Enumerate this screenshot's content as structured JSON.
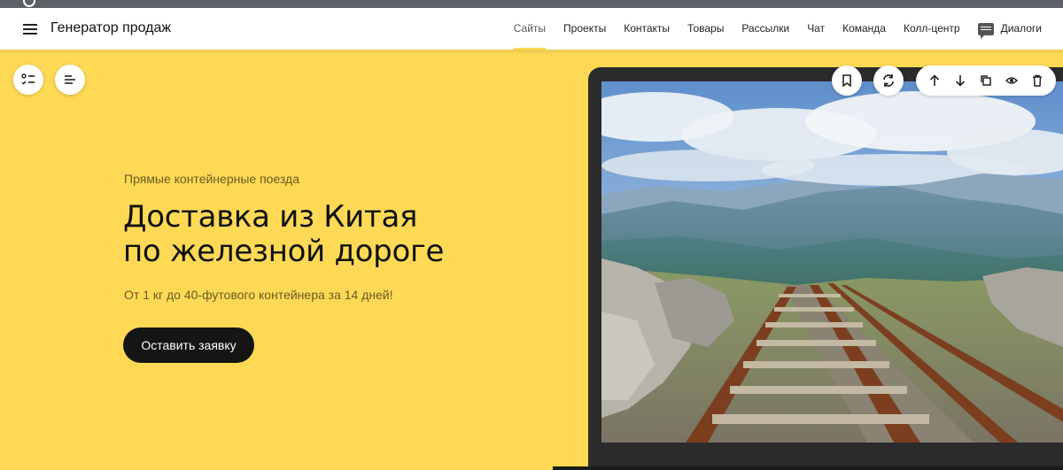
{
  "header": {
    "brand": "Генератор продаж",
    "nav": [
      {
        "label": "Сайты",
        "active": true
      },
      {
        "label": "Проекты",
        "active": false
      },
      {
        "label": "Контакты",
        "active": false
      },
      {
        "label": "Товары",
        "active": false
      },
      {
        "label": "Рассылки",
        "active": false
      },
      {
        "label": "Чат",
        "active": false
      },
      {
        "label": "Команда",
        "active": false
      },
      {
        "label": "Колл-центр",
        "active": false
      }
    ],
    "dialogs_label": "Диалоги"
  },
  "hero": {
    "eyebrow": "Прямые контейнерные поезда",
    "title_line1": "Доставка из Китая",
    "title_line2": "по железной дороге",
    "subtitle": "От 1 кг до 40-футового контейнера за 14 дней!",
    "cta": "Оставить заявку",
    "background_color": "#fdd955"
  },
  "tools_left": [
    "checklist-icon",
    "align-left-icon"
  ],
  "tools_right": [
    "bookmark-icon",
    "refresh-icon",
    "arrow-up-icon",
    "arrow-down-icon",
    "copy-icon",
    "eye-icon",
    "trash-icon"
  ],
  "image": {
    "icon": "railway-mountains-photo"
  }
}
